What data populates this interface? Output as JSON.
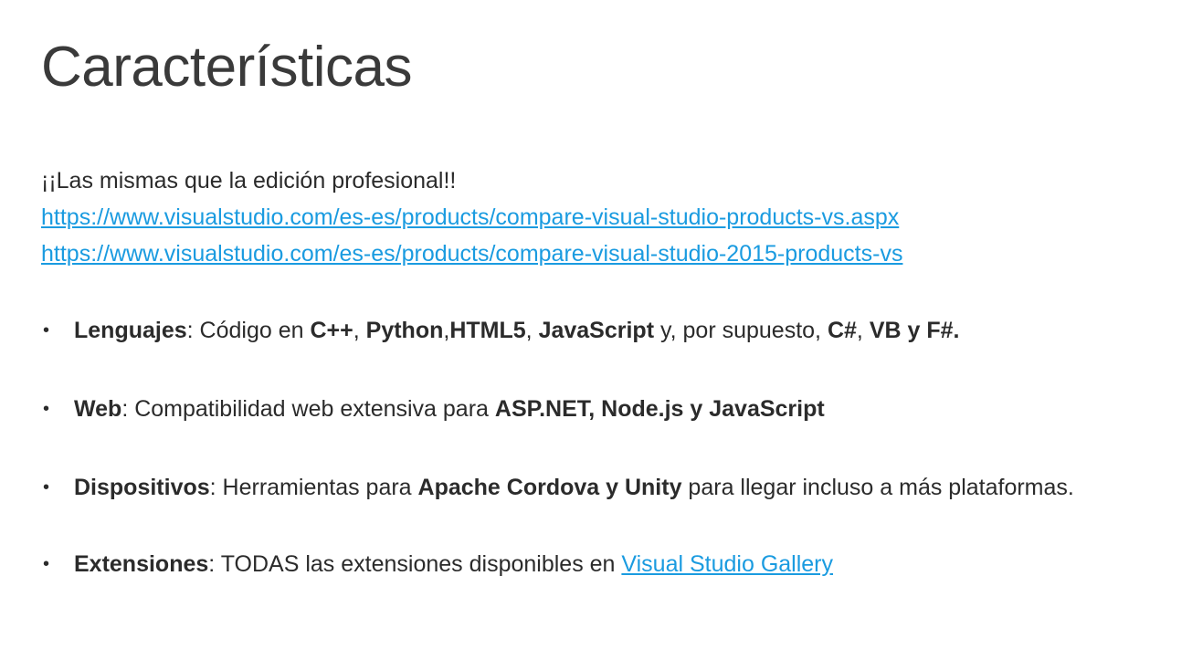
{
  "slide": {
    "title": "Características",
    "intro": "¡¡Las mismas que la edición profesional!!",
    "links": [
      "https://www.visualstudio.com/es-es/products/compare-visual-studio-products-vs.aspx",
      "https://www.visualstudio.com/es-es/products/compare-visual-studio-2015-products-vs"
    ],
    "bullets": {
      "lenguajes": {
        "label": "Lenguajes",
        "t1": ": Código en ",
        "b1": "C++",
        "t2": ", ",
        "b2": "Python",
        "t3": ",",
        "b3": "HTML5",
        "t4": ", ",
        "b4": "JavaScript",
        "t5": " y, por supuesto, ",
        "b5": "C#",
        "t6": ", ",
        "b6": "VB y F#."
      },
      "web": {
        "label": "Web",
        "t1": ": Compatibilidad web extensiva para ",
        "b1": "ASP.NET, Node.js y JavaScript"
      },
      "dispositivos": {
        "label": "Dispositivos",
        "t1": ": Herramientas para ",
        "b1": "Apache Cordova y Unity",
        "t2": " para llegar incluso a más plataformas."
      },
      "extensiones": {
        "label": "Extensiones",
        "t1": ": TODAS las extensiones disponibles en ",
        "link": "Visual Studio Gallery"
      }
    }
  },
  "colors": {
    "link": "#1a9be0",
    "text": "#2b2b2b",
    "title": "#3a3a3a"
  }
}
